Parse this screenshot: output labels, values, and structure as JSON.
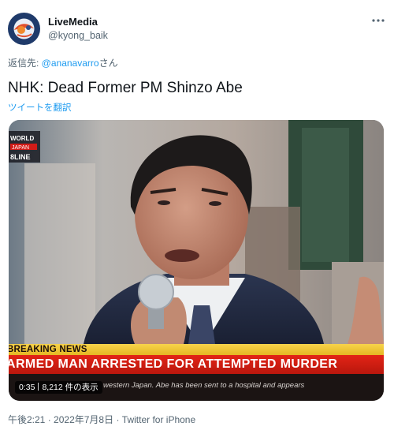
{
  "author": {
    "display_name": "LiveMedia",
    "handle": "@kyong_baik",
    "avatar_icon": "livemedia-logo-icon"
  },
  "menu": {
    "more_icon": "more-horizontal-icon"
  },
  "reply": {
    "prefix": "返信先: ",
    "mention": "@ananavarro",
    "suffix": "さん"
  },
  "tweet": {
    "text": "NHK: Dead Former PM Shinzo Abe",
    "translate_label": "ツイートを翻訳"
  },
  "media": {
    "type": "video",
    "chyron_label": "BREAKING NEWS",
    "chyron_headline": "ARMED MAN ARRESTED FOR ATTEMPTED MURDER",
    "ticker_text": "western Japan. Abe has been sent to a hospital and appears",
    "corner_logo_lines": [
      "WORLD",
      "JAPAN",
      "8LINE"
    ],
    "duration": "0:35",
    "views": "8,212 件の表示"
  },
  "footer": {
    "time": "午後2:21",
    "date": "2022年7月8日",
    "client": "Twitter for iPhone",
    "separator": "·"
  },
  "colors": {
    "link": "#1d9bf0",
    "secondary_text": "#536471",
    "chyron_yellow": "#f4c93a",
    "chyron_red": "#d81e12"
  }
}
